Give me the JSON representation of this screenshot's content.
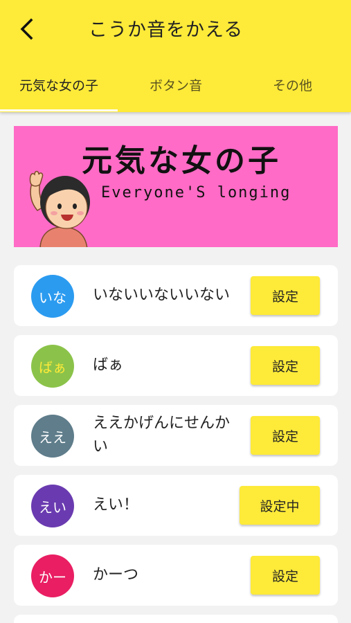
{
  "header": {
    "back_icon": "chevron-left-icon",
    "title": "こうか音をかえる",
    "background": "#fdea39"
  },
  "tabs": [
    {
      "label": "元気な女の子",
      "selected": true
    },
    {
      "label": "ボタン音",
      "selected": false
    },
    {
      "label": "その他",
      "selected": false
    }
  ],
  "banner": {
    "title": "元気な女の子",
    "subtitle": "Everyone'S longing",
    "background": "#ff6bc6"
  },
  "items": [
    {
      "avatar": "いな",
      "avatar_color": "#2b9bf0",
      "avatar_text_color": "#ffffff",
      "label": "いないいないいない",
      "button": "設定"
    },
    {
      "avatar": "ばぁ",
      "avatar_color": "#8bc34a",
      "avatar_text_color": "#fdea39",
      "label": "ばぁ",
      "button": "設定"
    },
    {
      "avatar": "ええ",
      "avatar_color": "#5f7d8b",
      "avatar_text_color": "#ffffff",
      "label": "ええかげんにせんかい",
      "button": "設定"
    },
    {
      "avatar": "えい",
      "avatar_color": "#6a3bb0",
      "avatar_text_color": "#ffffff",
      "label": "えい！",
      "button": "設定中"
    },
    {
      "avatar": "かー",
      "avatar_color": "#e91e63",
      "avatar_text_color": "#ffffff",
      "label": "かーつ",
      "button": "設定"
    }
  ]
}
